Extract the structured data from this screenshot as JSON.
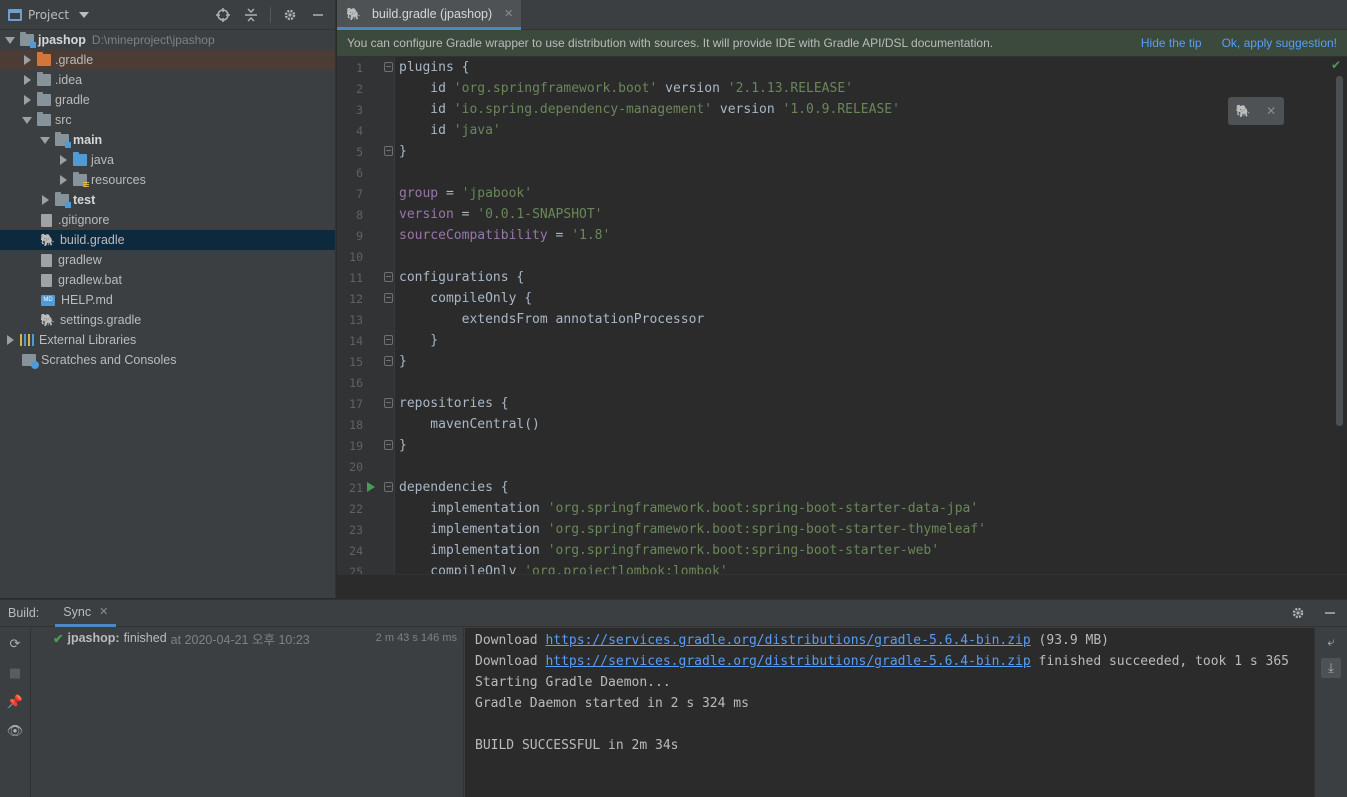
{
  "project_panel": {
    "title": "Project",
    "tree": [
      {
        "label": "jpashop",
        "path": "D:\\mineproject\\jpashop"
      },
      {
        "label": ".gradle"
      },
      {
        "label": ".idea"
      },
      {
        "label": "gradle"
      },
      {
        "label": "src"
      },
      {
        "label": "main"
      },
      {
        "label": "java"
      },
      {
        "label": "resources"
      },
      {
        "label": "test"
      },
      {
        "label": ".gitignore"
      },
      {
        "label": "build.gradle"
      },
      {
        "label": "gradlew"
      },
      {
        "label": "gradlew.bat"
      },
      {
        "label": "HELP.md"
      },
      {
        "label": "settings.gradle"
      },
      {
        "label": "External Libraries"
      },
      {
        "label": "Scratches and Consoles"
      }
    ]
  },
  "editor": {
    "tab_label": "build.gradle (jpashop)",
    "banner": {
      "message": "You can configure Gradle wrapper to use distribution with sources. It will provide IDE with Gradle API/DSL documentation.",
      "hide_link": "Hide the tip",
      "apply_link": "Ok, apply suggestion!"
    },
    "line_numbers": [
      "1",
      "2",
      "3",
      "4",
      "5",
      "6",
      "7",
      "8",
      "9",
      "10",
      "11",
      "12",
      "13",
      "14",
      "15",
      "16",
      "17",
      "18",
      "19",
      "20",
      "21",
      "22",
      "23",
      "24",
      "25"
    ],
    "code": {
      "l1": "plugins {",
      "l2_a": "    id ",
      "l2_b": "'org.springframework.boot'",
      "l2_c": " version ",
      "l2_d": "'2.1.13.RELEASE'",
      "l3_a": "    id ",
      "l3_b": "'io.spring.dependency-management'",
      "l3_c": " version ",
      "l3_d": "'1.0.9.RELEASE'",
      "l4_a": "    id ",
      "l4_b": "'java'",
      "l5": "}",
      "l7_a": "group",
      "l7_b": " = ",
      "l7_c": "'jpabook'",
      "l8_a": "version",
      "l8_b": " = ",
      "l8_c": "'0.0.1-SNAPSHOT'",
      "l9_a": "sourceCompatibility",
      "l9_b": " = ",
      "l9_c": "'1.8'",
      "l11": "configurations {",
      "l12": "    compileOnly {",
      "l13": "        extendsFrom annotationProcessor",
      "l14": "    }",
      "l15": "}",
      "l17": "repositories {",
      "l18": "    mavenCentral()",
      "l19": "}",
      "l21": "dependencies {",
      "l22_a": "    implementation ",
      "l22_b": "'org.springframework.boot:spring-boot-starter-data-jpa'",
      "l23_a": "    implementation ",
      "l23_b": "'org.springframework.boot:spring-boot-starter-thymeleaf'",
      "l24_a": "    implementation ",
      "l24_b": "'org.springframework.boot:spring-boot-starter-web'",
      "l25_a": "    compileOnly ",
      "l25_b": "'org.projectlombok:lombok'"
    }
  },
  "build_panel": {
    "label": "Build:",
    "tab": "Sync",
    "result": {
      "name": "jpashop:",
      "status": "finished",
      "at": "at 2020-04-21 오후 10:23",
      "duration": "2 m 43 s 146 ms"
    },
    "console": {
      "line1_a": "Download ",
      "line1_url": "https://services.gradle.org/distributions/gradle-5.6.4-bin.zip",
      "line1_b": " (93.9 MB)",
      "line2_a": "Download ",
      "line2_url": "https://services.gradle.org/distributions/gradle-5.6.4-bin.zip",
      "line2_b": " finished succeeded, took 1 s 365",
      "line3": "Starting Gradle Daemon...",
      "line4": "Gradle Daemon started in 2 s 324 ms",
      "line5": "",
      "line6": "BUILD SUCCESSFUL in 2m 34s"
    }
  },
  "colors": {
    "accent": "#4a88c7",
    "success": "#499c54",
    "link": "#589df6",
    "string": "#6a8759",
    "property": "#9876aa"
  }
}
